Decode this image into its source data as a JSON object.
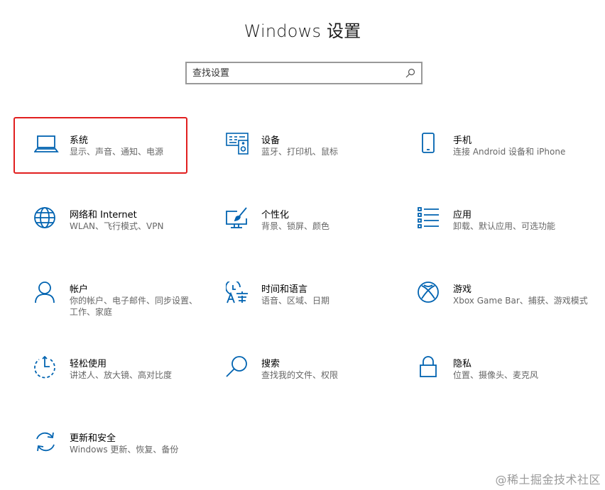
{
  "page": {
    "title": "Windows 设置"
  },
  "search": {
    "placeholder": "查找设置",
    "value": "",
    "icon": "search-icon"
  },
  "accent_color": "#0063b1",
  "highlight_color": "#e11f1f",
  "tiles": [
    {
      "name": "系统",
      "desc": "显示、声音、通知、电源",
      "icon": "laptop-icon",
      "highlighted": true
    },
    {
      "name": "设备",
      "desc": "蓝牙、打印机、鼠标",
      "icon": "keyboard-speaker-icon"
    },
    {
      "name": "手机",
      "desc": "连接 Android 设备和 iPhone",
      "icon": "phone-icon"
    },
    {
      "name": "网络和 Internet",
      "desc": "WLAN、飞行模式、VPN",
      "icon": "globe-icon"
    },
    {
      "name": "个性化",
      "desc": "背景、锁屏、颜色",
      "icon": "paint-brush-icon"
    },
    {
      "name": "应用",
      "desc": "卸载、默认应用、可选功能",
      "icon": "apps-list-icon"
    },
    {
      "name": "帐户",
      "desc": "你的帐户、电子邮件、同步设置、工作、家庭",
      "icon": "person-icon"
    },
    {
      "name": "时间和语言",
      "desc": "语音、区域、日期",
      "icon": "time-language-icon"
    },
    {
      "name": "游戏",
      "desc": "Xbox Game Bar、捕获、游戏模式",
      "icon": "xbox-icon"
    },
    {
      "name": "轻松使用",
      "desc": "讲述人、放大镜、高对比度",
      "icon": "ease-of-access-icon"
    },
    {
      "name": "搜索",
      "desc": "查找我的文件、权限",
      "icon": "search-magnifier-icon"
    },
    {
      "name": "隐私",
      "desc": "位置、摄像头、麦克风",
      "icon": "lock-icon"
    },
    {
      "name": "更新和安全",
      "desc": "Windows 更新、恢复、备份",
      "icon": "update-sync-icon"
    }
  ],
  "watermark": "@稀土掘金技术社区"
}
